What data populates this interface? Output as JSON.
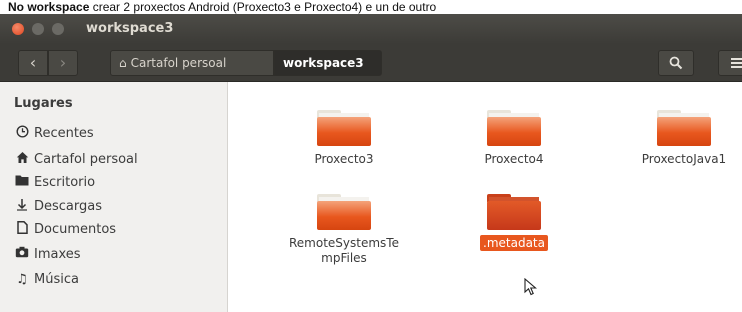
{
  "caption": {
    "bold": "No workspace",
    "rest": " crear 2 proxectos Android (Proxecto3 e Proxecto4) e un de outro"
  },
  "window": {
    "title": "workspace3"
  },
  "breadcrumb": {
    "home": "Cartafol persoal",
    "current": "workspace3"
  },
  "icons": {
    "back": "chevron-left-icon",
    "forward": "chevron-right-icon",
    "home": "home-icon",
    "search": "search-icon",
    "menu": "hamburger-menu-icon"
  },
  "sidebar": {
    "heading": "Lugares",
    "items": [
      {
        "label": "Recentes",
        "icon": "clock-icon"
      },
      {
        "label": "Cartafol persoal",
        "icon": "home-icon"
      },
      {
        "label": "Escritorio",
        "icon": "desktop-folder-icon"
      },
      {
        "label": "Descargas",
        "icon": "download-icon"
      },
      {
        "label": "Documentos",
        "icon": "document-icon"
      },
      {
        "label": "Imaxes",
        "icon": "camera-icon"
      },
      {
        "label": "Música",
        "icon": "music-icon"
      }
    ]
  },
  "files": [
    {
      "name": "Proxecto3",
      "selected": false
    },
    {
      "name": "Proxecto4",
      "selected": false
    },
    {
      "name": "ProxectoJava1",
      "selected": false
    },
    {
      "name": "RemoteSystemsTe mpFiles",
      "selected": false
    },
    {
      "name": ".metadata",
      "selected": true
    }
  ],
  "colors": {
    "accent": "#e8571e",
    "titlebar": "#3c3b37",
    "sidebar": "#f1f0ee"
  }
}
